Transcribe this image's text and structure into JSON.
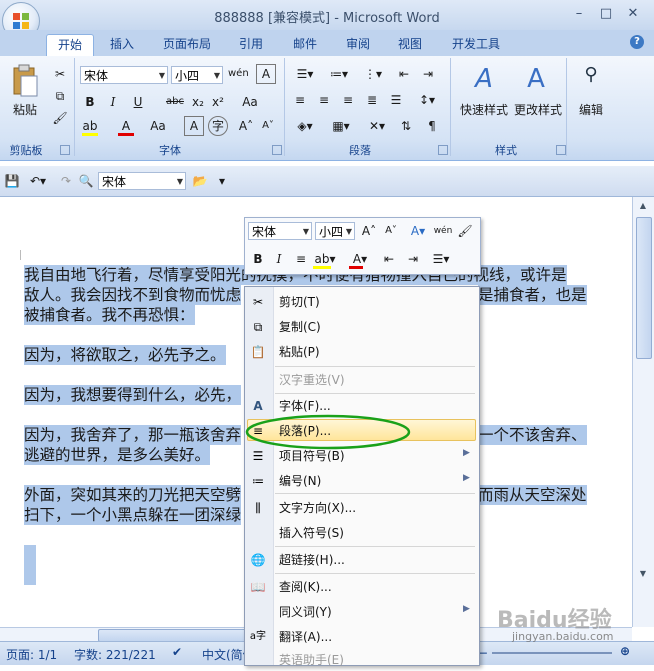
{
  "window": {
    "title": "888888 [兼容模式] - Microsoft Word",
    "minimize": "–",
    "restore": "□",
    "close": "✕"
  },
  "tabs": [
    "开始",
    "插入",
    "页面布局",
    "引用",
    "邮件",
    "审阅",
    "视图",
    "开发工具"
  ],
  "ribbon": {
    "groups": {
      "clipboard": "剪贴板",
      "font": "字体",
      "paragraph": "段落",
      "styles": "样式"
    },
    "paste_label": "粘贴",
    "font_name": "宋体",
    "font_size": "小四",
    "quick_styles_label": "快速样式",
    "change_styles_label": "更改样式",
    "edit_label": "编辑",
    "colors": {
      "accent": "#15428b",
      "highlight": "#ffff00",
      "font_color": "#e00000"
    }
  },
  "qat": {
    "font_name": "宋体"
  },
  "document": {
    "lines": [
      "我自由地飞行着，尽情享受阳光的抚摸，不时便有猎物撞入自己的视线，或许是",
      "敌人。我会因找不到食物而忧虑",
      "被捕食者。我不再恐惧：",
      "因为，将欲取之，必先予之。",
      "因为，我想要得到什么，必先，",
      "因为，我舍弃了，那一瓶该舍弃",
      "逃避的世界，是多么美好。",
      "外面，突如其来的刀光把天空劈",
      "扫下，一个小黑点躲在一团深绿"
    ],
    "right_fragments": {
      "line2": "是捕食者，也是",
      "line6": "一个不该舍弃、",
      "line8": "而雨从天空深处"
    }
  },
  "minibar": {
    "font_name": "宋体",
    "font_size": "小四"
  },
  "context_menu": [
    {
      "label": "剪切(T)",
      "icon": "scissors-icon",
      "enabled": true
    },
    {
      "label": "复制(C)",
      "icon": "copy-icon",
      "enabled": true
    },
    {
      "label": "粘贴(P)",
      "icon": "paste-icon",
      "enabled": true
    },
    {
      "label": "汉字重选(V)",
      "icon": "",
      "enabled": false
    },
    {
      "label": "字体(F)...",
      "icon": "font-icon",
      "enabled": true
    },
    {
      "label": "段落(P)...",
      "icon": "paragraph-icon",
      "enabled": true,
      "highlighted": true
    },
    {
      "label": "项目符号(B)",
      "icon": "bullets-icon",
      "enabled": true,
      "submenu": true
    },
    {
      "label": "编号(N)",
      "icon": "numbering-icon",
      "enabled": true,
      "submenu": true
    },
    {
      "label": "文字方向(X)...",
      "icon": "text-direction-icon",
      "enabled": true
    },
    {
      "label": "插入符号(S)",
      "icon": "",
      "enabled": true
    },
    {
      "label": "超链接(H)...",
      "icon": "hyperlink-icon",
      "enabled": true
    },
    {
      "label": "查阅(K)...",
      "icon": "lookup-icon",
      "enabled": true
    },
    {
      "label": "同义词(Y)",
      "icon": "",
      "enabled": true,
      "submenu": true
    },
    {
      "label": "翻译(A)...",
      "icon": "translate-icon",
      "enabled": true
    },
    {
      "label": "英语助手(E)",
      "icon": "",
      "enabled": false
    }
  ],
  "statusbar": {
    "page": "页面: 1/1",
    "words": "字数: 221/221",
    "language": "中文(简体"
  },
  "watermark": {
    "brand": "Baidu经验",
    "url": "jingyan.baidu.com"
  },
  "annotation": {
    "ellipse_color": "#1aa11a"
  }
}
